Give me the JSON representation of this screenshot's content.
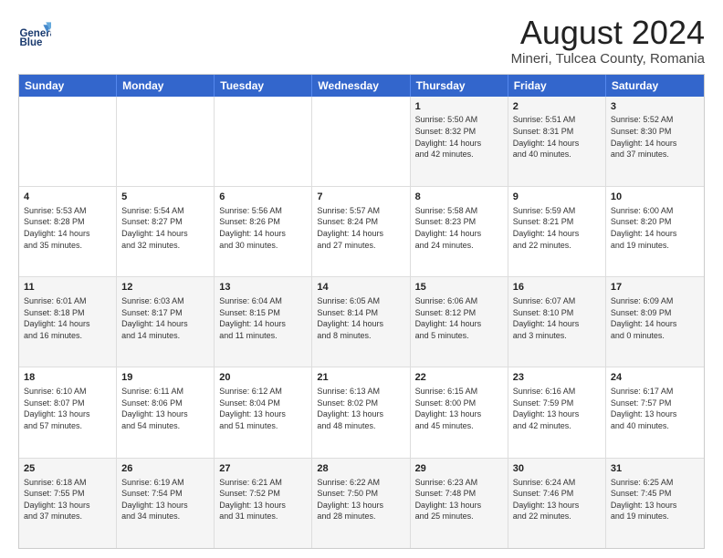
{
  "header": {
    "logo_line1": "General",
    "logo_line2": "Blue",
    "main_title": "August 2024",
    "subtitle": "Mineri, Tulcea County, Romania"
  },
  "weekdays": [
    "Sunday",
    "Monday",
    "Tuesday",
    "Wednesday",
    "Thursday",
    "Friday",
    "Saturday"
  ],
  "rows": [
    [
      {
        "day": "",
        "text": ""
      },
      {
        "day": "",
        "text": ""
      },
      {
        "day": "",
        "text": ""
      },
      {
        "day": "",
        "text": ""
      },
      {
        "day": "1",
        "text": "Sunrise: 5:50 AM\nSunset: 8:32 PM\nDaylight: 14 hours\nand 42 minutes."
      },
      {
        "day": "2",
        "text": "Sunrise: 5:51 AM\nSunset: 8:31 PM\nDaylight: 14 hours\nand 40 minutes."
      },
      {
        "day": "3",
        "text": "Sunrise: 5:52 AM\nSunset: 8:30 PM\nDaylight: 14 hours\nand 37 minutes."
      }
    ],
    [
      {
        "day": "4",
        "text": "Sunrise: 5:53 AM\nSunset: 8:28 PM\nDaylight: 14 hours\nand 35 minutes."
      },
      {
        "day": "5",
        "text": "Sunrise: 5:54 AM\nSunset: 8:27 PM\nDaylight: 14 hours\nand 32 minutes."
      },
      {
        "day": "6",
        "text": "Sunrise: 5:56 AM\nSunset: 8:26 PM\nDaylight: 14 hours\nand 30 minutes."
      },
      {
        "day": "7",
        "text": "Sunrise: 5:57 AM\nSunset: 8:24 PM\nDaylight: 14 hours\nand 27 minutes."
      },
      {
        "day": "8",
        "text": "Sunrise: 5:58 AM\nSunset: 8:23 PM\nDaylight: 14 hours\nand 24 minutes."
      },
      {
        "day": "9",
        "text": "Sunrise: 5:59 AM\nSunset: 8:21 PM\nDaylight: 14 hours\nand 22 minutes."
      },
      {
        "day": "10",
        "text": "Sunrise: 6:00 AM\nSunset: 8:20 PM\nDaylight: 14 hours\nand 19 minutes."
      }
    ],
    [
      {
        "day": "11",
        "text": "Sunrise: 6:01 AM\nSunset: 8:18 PM\nDaylight: 14 hours\nand 16 minutes."
      },
      {
        "day": "12",
        "text": "Sunrise: 6:03 AM\nSunset: 8:17 PM\nDaylight: 14 hours\nand 14 minutes."
      },
      {
        "day": "13",
        "text": "Sunrise: 6:04 AM\nSunset: 8:15 PM\nDaylight: 14 hours\nand 11 minutes."
      },
      {
        "day": "14",
        "text": "Sunrise: 6:05 AM\nSunset: 8:14 PM\nDaylight: 14 hours\nand 8 minutes."
      },
      {
        "day": "15",
        "text": "Sunrise: 6:06 AM\nSunset: 8:12 PM\nDaylight: 14 hours\nand 5 minutes."
      },
      {
        "day": "16",
        "text": "Sunrise: 6:07 AM\nSunset: 8:10 PM\nDaylight: 14 hours\nand 3 minutes."
      },
      {
        "day": "17",
        "text": "Sunrise: 6:09 AM\nSunset: 8:09 PM\nDaylight: 14 hours\nand 0 minutes."
      }
    ],
    [
      {
        "day": "18",
        "text": "Sunrise: 6:10 AM\nSunset: 8:07 PM\nDaylight: 13 hours\nand 57 minutes."
      },
      {
        "day": "19",
        "text": "Sunrise: 6:11 AM\nSunset: 8:06 PM\nDaylight: 13 hours\nand 54 minutes."
      },
      {
        "day": "20",
        "text": "Sunrise: 6:12 AM\nSunset: 8:04 PM\nDaylight: 13 hours\nand 51 minutes."
      },
      {
        "day": "21",
        "text": "Sunrise: 6:13 AM\nSunset: 8:02 PM\nDaylight: 13 hours\nand 48 minutes."
      },
      {
        "day": "22",
        "text": "Sunrise: 6:15 AM\nSunset: 8:00 PM\nDaylight: 13 hours\nand 45 minutes."
      },
      {
        "day": "23",
        "text": "Sunrise: 6:16 AM\nSunset: 7:59 PM\nDaylight: 13 hours\nand 42 minutes."
      },
      {
        "day": "24",
        "text": "Sunrise: 6:17 AM\nSunset: 7:57 PM\nDaylight: 13 hours\nand 40 minutes."
      }
    ],
    [
      {
        "day": "25",
        "text": "Sunrise: 6:18 AM\nSunset: 7:55 PM\nDaylight: 13 hours\nand 37 minutes."
      },
      {
        "day": "26",
        "text": "Sunrise: 6:19 AM\nSunset: 7:54 PM\nDaylight: 13 hours\nand 34 minutes."
      },
      {
        "day": "27",
        "text": "Sunrise: 6:21 AM\nSunset: 7:52 PM\nDaylight: 13 hours\nand 31 minutes."
      },
      {
        "day": "28",
        "text": "Sunrise: 6:22 AM\nSunset: 7:50 PM\nDaylight: 13 hours\nand 28 minutes."
      },
      {
        "day": "29",
        "text": "Sunrise: 6:23 AM\nSunset: 7:48 PM\nDaylight: 13 hours\nand 25 minutes."
      },
      {
        "day": "30",
        "text": "Sunrise: 6:24 AM\nSunset: 7:46 PM\nDaylight: 13 hours\nand 22 minutes."
      },
      {
        "day": "31",
        "text": "Sunrise: 6:25 AM\nSunset: 7:45 PM\nDaylight: 13 hours\nand 19 minutes."
      }
    ]
  ],
  "alt_rows": [
    0,
    2,
    4
  ],
  "colors": {
    "header_bg": "#3366cc",
    "alt_bg": "#f5f5f5",
    "white_bg": "#ffffff"
  }
}
